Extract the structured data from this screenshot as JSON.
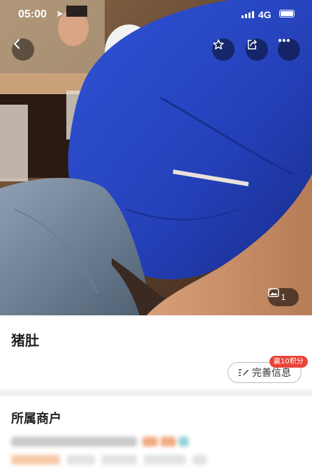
{
  "status_bar": {
    "time": "05:00",
    "network": "4G"
  },
  "header": {
    "back_icon": "chevron-left-icon",
    "favorite_icon": "star-icon",
    "share_icon": "share-icon",
    "more_icon": "more-icon"
  },
  "photo": {
    "count": "1"
  },
  "item": {
    "title": "猪肚",
    "complete_label": "完善信息",
    "reward_badge": "赢10积分"
  },
  "merchant": {
    "heading": "所属商户"
  },
  "colors": {
    "reward_red": "#e8443a",
    "divider_gray": "#f2f2f2",
    "shirt_blue": "#2746c8"
  }
}
